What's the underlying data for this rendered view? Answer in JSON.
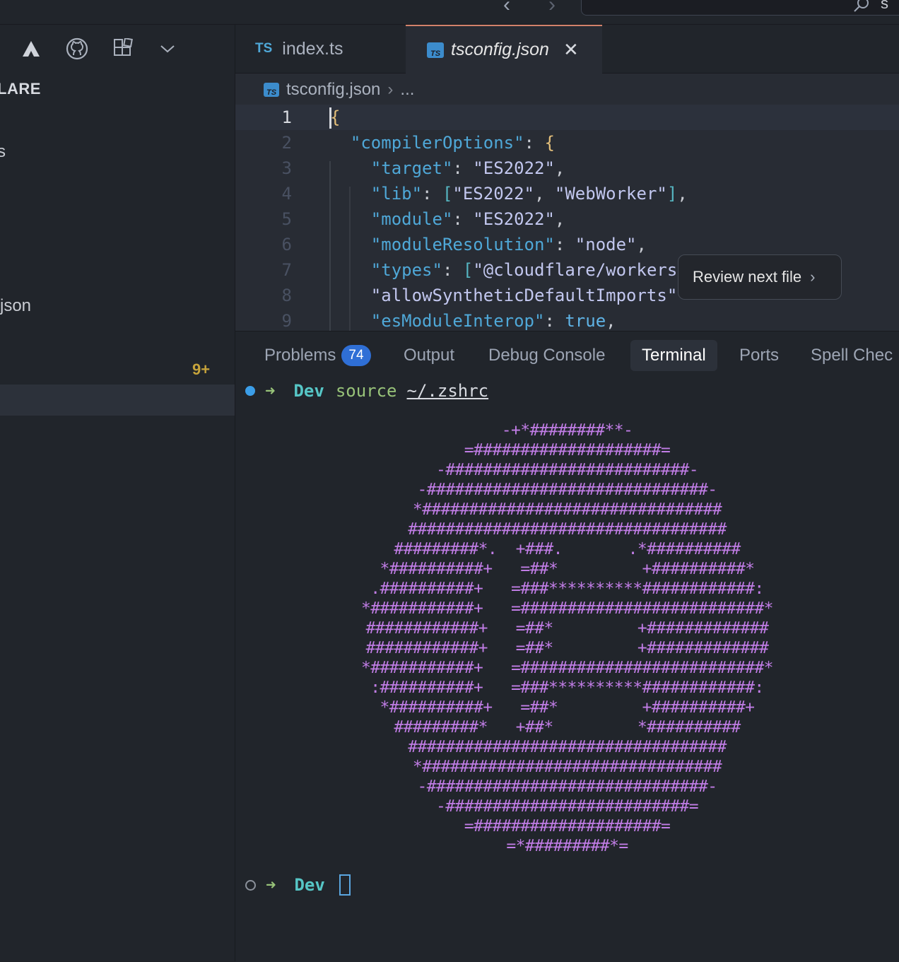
{
  "titlebar": {
    "nav_back": "‹",
    "nav_forward": "›",
    "search_text": "s"
  },
  "sidebar": {
    "section_title": "LARE",
    "item_s": "s",
    "item_json": "json",
    "badge": "9+"
  },
  "tabs": [
    {
      "badge": "TS",
      "label": "index.ts"
    },
    {
      "badge": "TS",
      "label": "tsconfig.json",
      "close": "✕"
    }
  ],
  "breadcrumb": {
    "file": "tsconfig.json",
    "separator": "›",
    "more": "..."
  },
  "editor": {
    "line_numbers": [
      "1",
      "2",
      "3",
      "4",
      "5",
      "6",
      "7",
      "8",
      "9"
    ],
    "lines": [
      "{",
      "  \"compilerOptions\": {",
      "    \"target\": \"ES2022\",",
      "    \"lib\": [\"ES2022\", \"WebWorker\"],",
      "    \"module\": \"ES2022\",",
      "    \"moduleResolution\": \"node\",",
      "    \"types\": [\"@cloudflare/workers",
      "    \"allowSyntheticDefaultImports\"",
      "    \"esModuleInterop\": true,"
    ],
    "review_button": "Review next file",
    "review_chevron": "›"
  },
  "panel": {
    "tabs": {
      "problems": "Problems",
      "problems_count": "74",
      "output": "Output",
      "debug_console": "Debug Console",
      "terminal": "Terminal",
      "ports": "Ports",
      "spell_checker": "Spell Chec"
    }
  },
  "terminal": {
    "prompt_arrow": "➜",
    "dir": "Dev",
    "command": "source",
    "argument": "~/.zshrc",
    "ascii_art": [
      "-+*########**-",
      "=####################=",
      "-##########################-",
      "-##############################-",
      "*################################",
      "##################################",
      "#########*.  +###.       .*##########",
      "*##########+   =##*         +##########*",
      ".##########+   =###**********############:",
      "*###########+   =##########################*",
      "############+   =##*         +#############",
      "############+   =##*         +#############",
      "*###########+   =##########################*",
      ":##########+   =###**********############:",
      "*##########+   =##*         +##########+",
      "#########*   +##*         *##########",
      "##################################",
      "*################################",
      "-##############################-",
      "-##########################=",
      "=####################=",
      "=*#########*="
    ]
  }
}
